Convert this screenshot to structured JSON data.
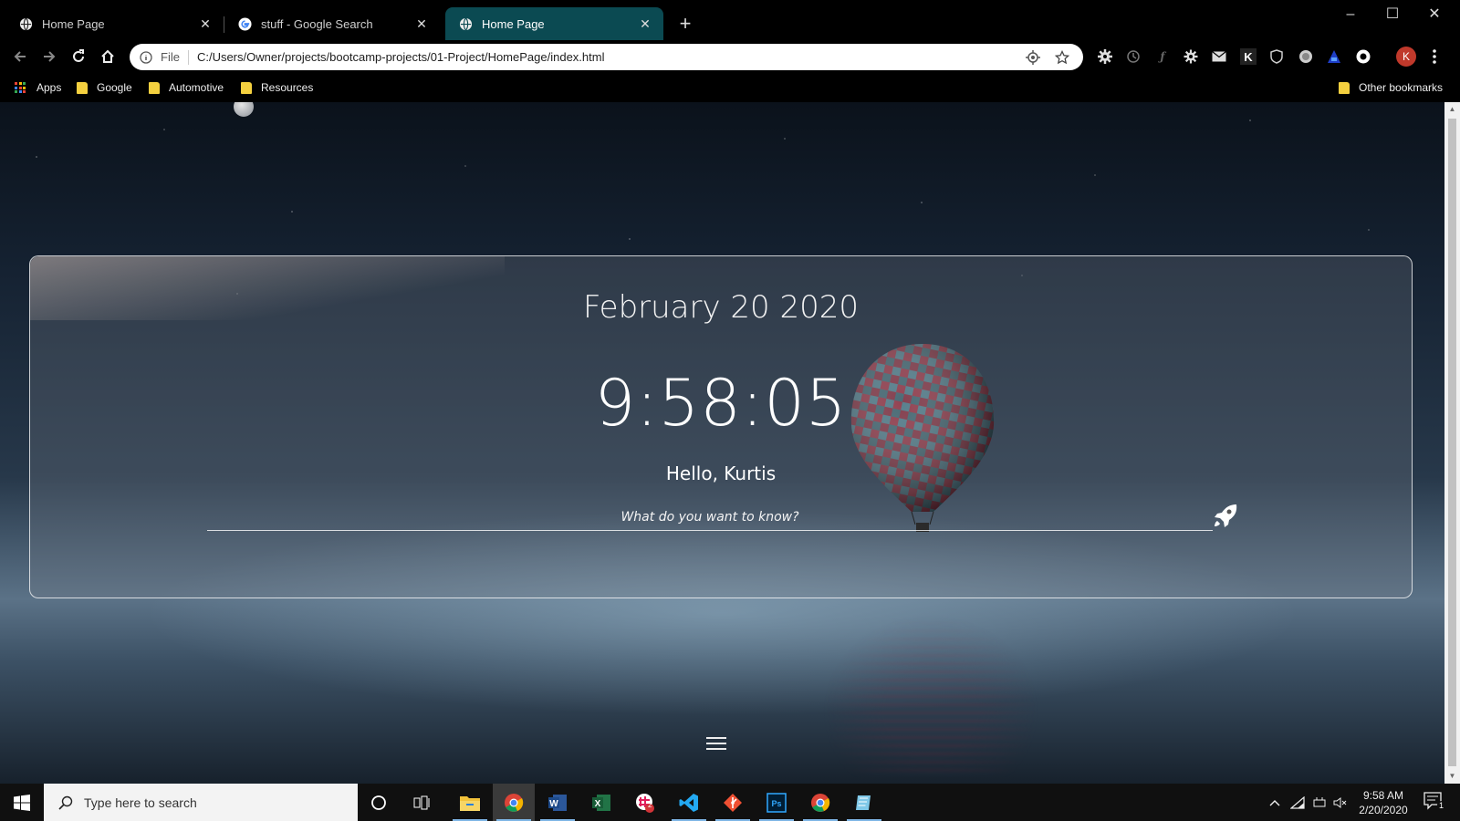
{
  "browser": {
    "tabs": [
      {
        "label": "Home Page",
        "active": false
      },
      {
        "label": "stuff - Google Search",
        "active": false
      },
      {
        "label": "Home Page",
        "active": true
      }
    ],
    "new_tab_label": "+",
    "window_controls": {
      "minimize": "–",
      "maximize": "☐",
      "close": "✕"
    },
    "address_bar": {
      "scheme_label": "File",
      "url": "C:/Users/Owner/projects/bootcamp-projects/01-Project/HomePage/index.html"
    },
    "profile_initial": "K",
    "extension_letter": "K",
    "bookmarks": [
      {
        "label": "Apps",
        "icon": "apps-grid-icon"
      },
      {
        "label": "Google",
        "icon": "folder-icon"
      },
      {
        "label": "Automotive",
        "icon": "folder-icon"
      },
      {
        "label": "Resources",
        "icon": "folder-icon"
      }
    ],
    "other_bookmarks": "Other bookmarks"
  },
  "page": {
    "date": "February 20 2020",
    "time": "9:58:05",
    "greeting": "Hello, Kurtis",
    "search_placeholder": "What do you want to know?",
    "search_value": ""
  },
  "taskbar": {
    "search_placeholder": "Type here to search",
    "apps": [
      "file-explorer",
      "chrome",
      "word",
      "excel",
      "slack",
      "vscode",
      "git",
      "photoshop",
      "chrome",
      "notes"
    ],
    "slack_badge": "2",
    "clock_time": "9:58 AM",
    "clock_date": "2/20/2020",
    "notification_count": "1"
  },
  "colors": {
    "active_tab": "#0b4a52",
    "profile_avatar": "#c0392b",
    "bookmark_folder": "#f4d03f"
  }
}
